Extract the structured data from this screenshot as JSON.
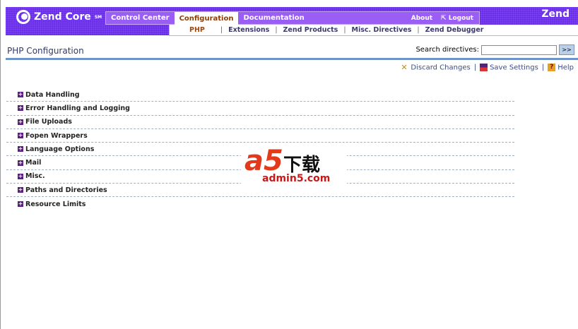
{
  "header": {
    "logo": "Zend Core",
    "logo_tm": "SM",
    "brand": "Zend",
    "tabs": [
      {
        "label": "Control Center"
      },
      {
        "label": "Configuration",
        "active": true
      },
      {
        "label": "Documentation"
      }
    ],
    "about": "About",
    "logout": "Logout",
    "subnav": [
      "PHP",
      "Extensions",
      "Zend Products",
      "Misc. Directives",
      "Zend Debugger"
    ]
  },
  "page": {
    "title": "PHP Configuration",
    "search_label": "Search directives:",
    "search_value": "",
    "go": ">>"
  },
  "actions": {
    "discard": "Discard Changes",
    "save": "Save Settings",
    "help": "Help",
    "sep": "|"
  },
  "sections": [
    "Data Handling",
    "Error Handling and Logging",
    "File Uploads",
    "Fopen Wrappers",
    "Language Options",
    "Mail",
    "Misc.",
    "Paths and Directories",
    "Resource Limits"
  ],
  "watermark": {
    "a": "a5",
    "cn": "下载",
    "url": "admin5.com"
  }
}
